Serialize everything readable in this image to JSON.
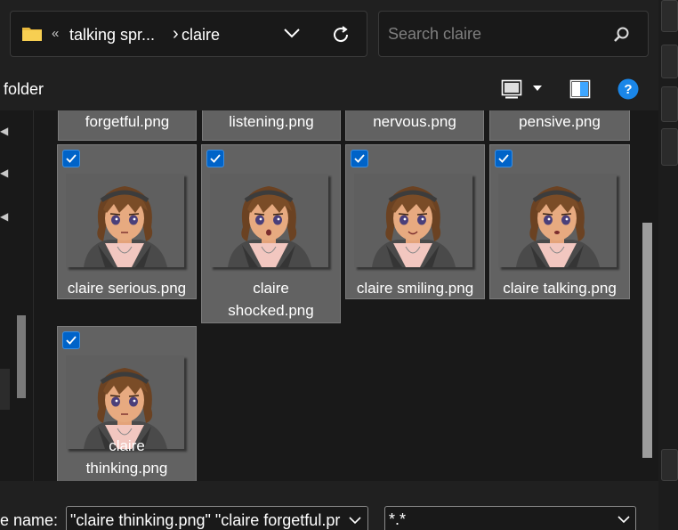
{
  "address_bar": {
    "overflow_chevron": "«",
    "breadcrumb_parent": "talking spr...",
    "separator": "›",
    "breadcrumb_current": "claire",
    "dropdown_icon": "chevron-down-icon",
    "refresh_icon": "refresh-icon"
  },
  "search": {
    "placeholder": "Search claire",
    "icon": "search-icon"
  },
  "command_bar": {
    "folder_label": "folder",
    "view_icon": "view-mode-icon",
    "preview_icon": "preview-pane-icon",
    "help_icon": "?"
  },
  "top_row_files": [
    {
      "name": "forgetful.png"
    },
    {
      "name": "listening.png"
    },
    {
      "name": "nervous.png"
    },
    {
      "name": "pensive.png"
    }
  ],
  "files": [
    {
      "name_line1": "claire serious.png",
      "name_line2": "",
      "selected": true,
      "mouth": "neutral"
    },
    {
      "name_line1": "claire",
      "name_line2": "shocked.png",
      "selected": true,
      "mouth": "open"
    },
    {
      "name_line1": "claire smiling.png",
      "name_line2": "",
      "selected": true,
      "mouth": "smile"
    },
    {
      "name_line1": "claire talking.png",
      "name_line2": "",
      "selected": true,
      "mouth": "talk"
    },
    {
      "name_line1": "claire",
      "name_line2": "thinking.png",
      "selected": true,
      "mouth": "neutral"
    }
  ],
  "bottom_bar": {
    "file_name_label": "le name:",
    "file_name_value": "\"claire thinking.png\" \"claire forgetful.pr",
    "file_type_value": "*.*"
  },
  "colors": {
    "accent": "#0063c8",
    "tile_bg": "#626262",
    "background": "#191919"
  }
}
